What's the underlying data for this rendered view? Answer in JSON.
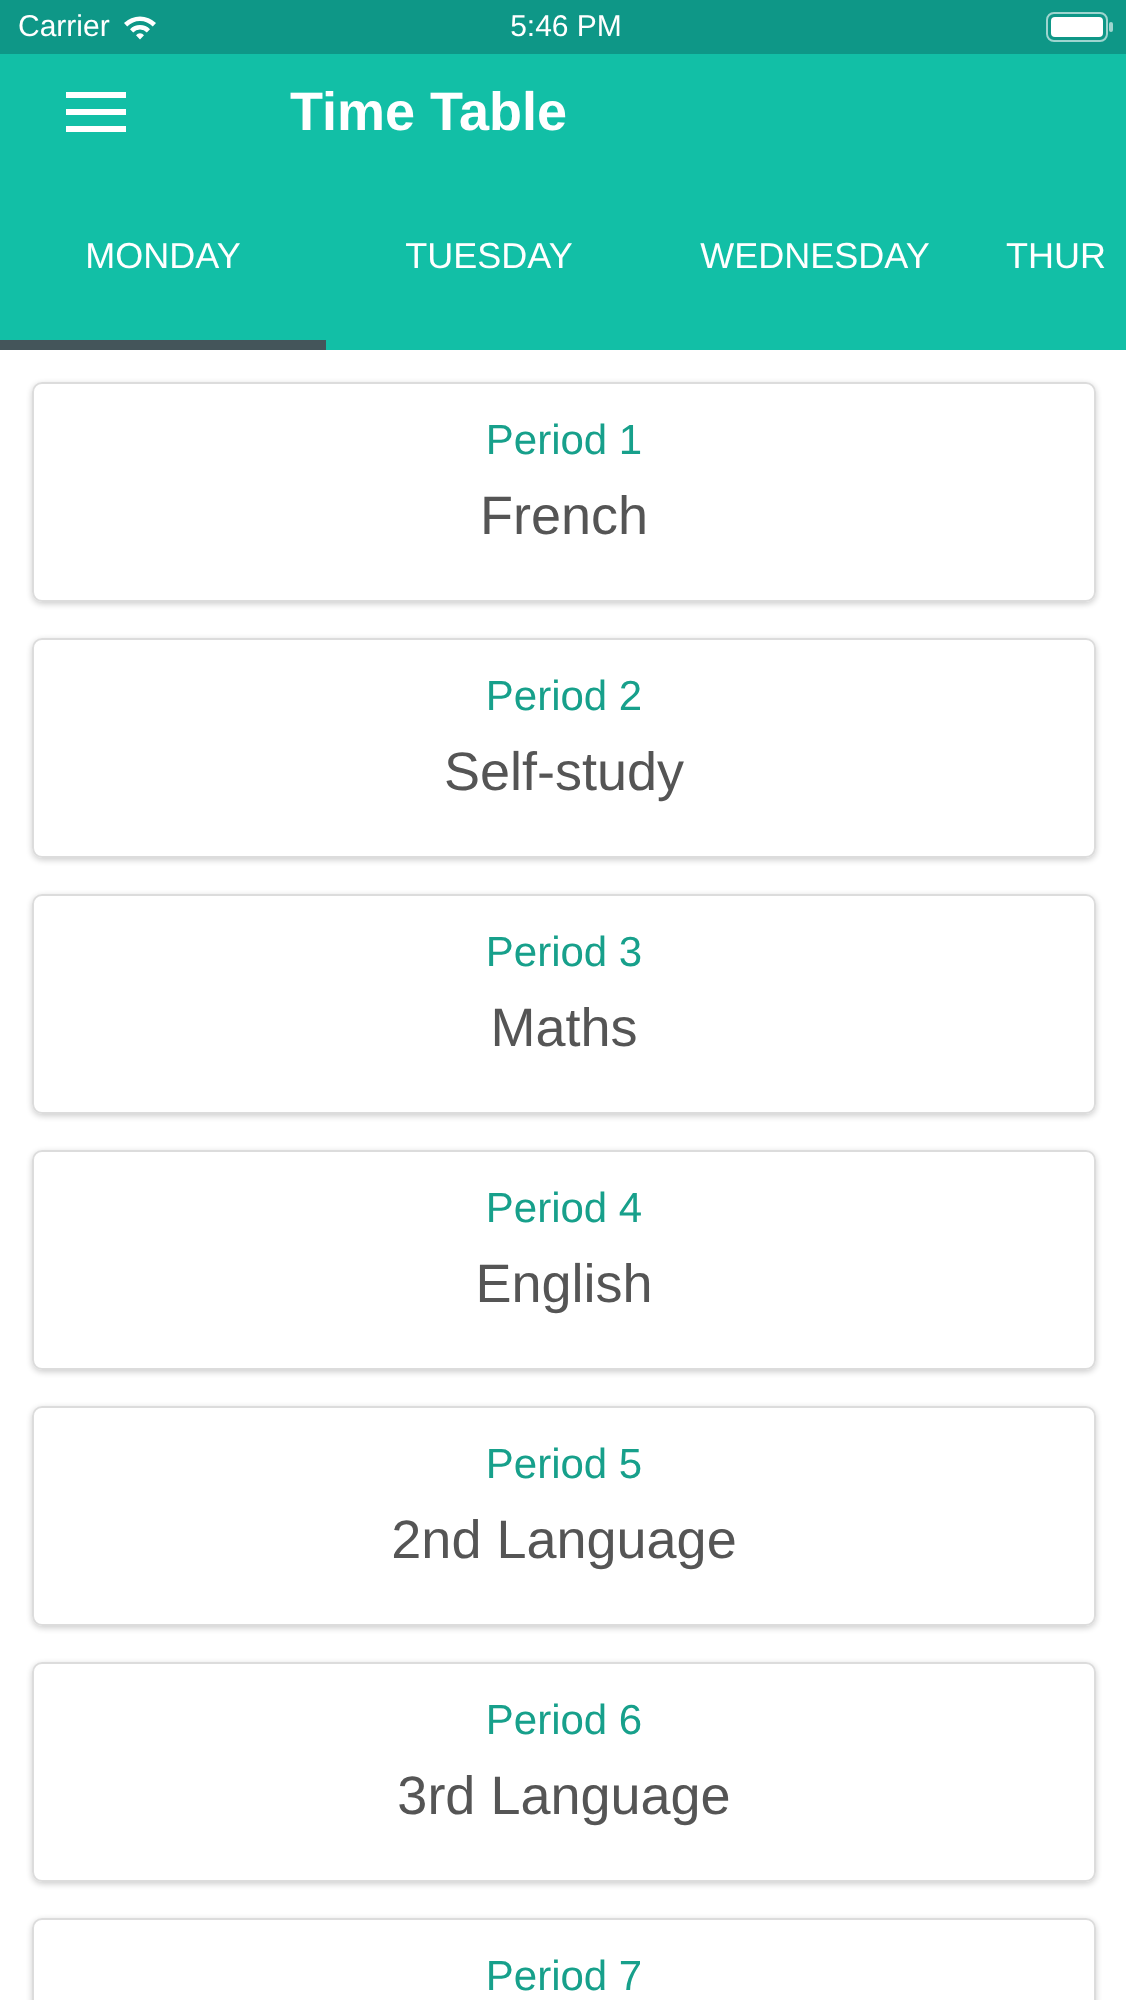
{
  "status_bar": {
    "carrier": "Carrier",
    "time": "5:46 PM"
  },
  "app_bar": {
    "title": "Time Table"
  },
  "tabs": [
    {
      "label": "MONDAY",
      "selected": true
    },
    {
      "label": "TUESDAY",
      "selected": false
    },
    {
      "label": "WEDNESDAY",
      "selected": false
    },
    {
      "label": "THUR",
      "selected": false
    }
  ],
  "periods": [
    {
      "period": "Period 1",
      "subject": "French"
    },
    {
      "period": "Period 2",
      "subject": "Self-study"
    },
    {
      "period": "Period 3",
      "subject": "Maths"
    },
    {
      "period": "Period 4",
      "subject": "English"
    },
    {
      "period": "Period 5",
      "subject": "2nd Language"
    },
    {
      "period": "Period 6",
      "subject": "3rd Language"
    },
    {
      "period": "Period 7"
    }
  ]
}
